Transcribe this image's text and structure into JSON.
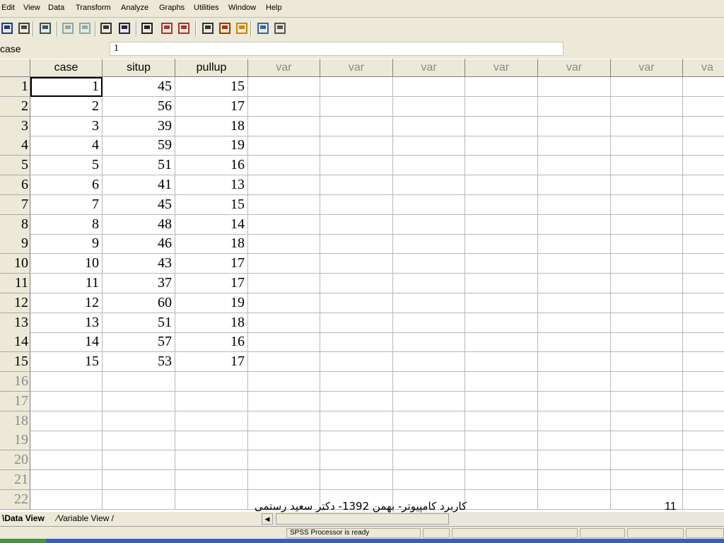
{
  "menu": [
    "Edit",
    "View",
    "Data",
    "Transform",
    "Analyze",
    "Graphs",
    "Utilities",
    "Window",
    "Help"
  ],
  "toolbar_icons": [
    "save-icon",
    "print-icon",
    "dialog-recall-icon",
    "undo-icon",
    "redo-icon",
    "goto-case-icon",
    "variables-icon",
    "find-icon",
    "insert-cases-icon",
    "insert-variable-icon",
    "split-file-icon",
    "weight-cases-icon",
    "select-cases-icon",
    "value-labels-icon",
    "use-sets-icon"
  ],
  "editor": {
    "cell_name": "case",
    "cell_value": "1"
  },
  "columns": [
    "case",
    "situp",
    "pullup",
    "var",
    "var",
    "var",
    "var",
    "var",
    "var",
    "va"
  ],
  "rows": [
    {
      "n": "1",
      "case": "1",
      "situp": "45",
      "pullup": "15"
    },
    {
      "n": "2",
      "case": "2",
      "situp": "56",
      "pullup": "17"
    },
    {
      "n": "3",
      "case": "3",
      "situp": "39",
      "pullup": "18"
    },
    {
      "n": "4",
      "case": "4",
      "situp": "59",
      "pullup": "19"
    },
    {
      "n": "5",
      "case": "5",
      "situp": "51",
      "pullup": "16"
    },
    {
      "n": "6",
      "case": "6",
      "situp": "41",
      "pullup": "13"
    },
    {
      "n": "7",
      "case": "7",
      "situp": "45",
      "pullup": "15"
    },
    {
      "n": "8",
      "case": "8",
      "situp": "48",
      "pullup": "14"
    },
    {
      "n": "9",
      "case": "9",
      "situp": "46",
      "pullup": "18"
    },
    {
      "n": "10",
      "case": "10",
      "situp": "43",
      "pullup": "17"
    },
    {
      "n": "11",
      "case": "11",
      "situp": "37",
      "pullup": "17"
    },
    {
      "n": "12",
      "case": "12",
      "situp": "60",
      "pullup": "19"
    },
    {
      "n": "13",
      "case": "13",
      "situp": "51",
      "pullup": "18"
    },
    {
      "n": "14",
      "case": "14",
      "situp": "57",
      "pullup": "16"
    },
    {
      "n": "15",
      "case": "15",
      "situp": "53",
      "pullup": "17"
    }
  ],
  "empty_rows": [
    "16",
    "17",
    "18",
    "19",
    "20",
    "21",
    "22"
  ],
  "tabs": {
    "data_view": "Data View",
    "variable_view": "Variable View"
  },
  "status": "SPSS Processor  is ready",
  "overlay": {
    "footer_text": "کاربرد کامپیوتر- بهمن 1392- دکتر سعید رستمی",
    "page_number": "11"
  },
  "colors": {
    "header_bg": "#ece9d8",
    "grid_bg": "#ffffff",
    "var_header_text": "#8a8a8a",
    "taskbar": "#2f5fd0"
  }
}
